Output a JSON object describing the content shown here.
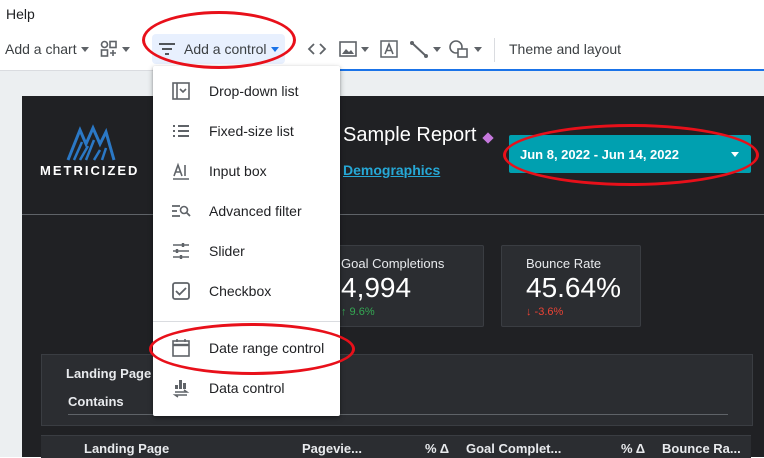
{
  "menubar": {
    "help": "Help"
  },
  "toolbar": {
    "add_chart": "Add a chart",
    "add_control": "Add a control",
    "theme_layout": "Theme and layout"
  },
  "control_menu": {
    "items": [
      {
        "label": "Drop-down list",
        "icon": "dropdown-list-icon"
      },
      {
        "label": "Fixed-size list",
        "icon": "fixed-size-list-icon"
      },
      {
        "label": "Input box",
        "icon": "input-box-icon"
      },
      {
        "label": "Advanced filter",
        "icon": "advanced-filter-icon"
      },
      {
        "label": "Slider",
        "icon": "slider-icon"
      },
      {
        "label": "Checkbox",
        "icon": "checkbox-icon"
      },
      {
        "label": "Date range control",
        "icon": "calendar-icon"
      },
      {
        "label": "Data control",
        "icon": "data-control-icon"
      }
    ]
  },
  "report": {
    "logo_text": "METRICIZED",
    "title": "Sample Report",
    "subtitle_link": "Demographics",
    "date_range": "Jun 8, 2022 - Jun 14, 2022",
    "scorecards": [
      {
        "title": "Goal Completions",
        "value": "4,994",
        "delta": "↑ 9.6%",
        "delta_color": "#34a853"
      },
      {
        "title": "Bounce Rate",
        "value": "45.64%",
        "delta": "↓ -3.6%",
        "delta_color": "#ea4335"
      }
    ],
    "filter": {
      "label": "Landing Page",
      "operator": "Contains"
    },
    "table_headers": [
      "Landing Page",
      "Pagevie...",
      "% Δ",
      "Goal Complet...",
      "% Δ",
      "Bounce Ra..."
    ]
  },
  "colors": {
    "accent": "#1a73e8",
    "date_button": "#00a0b0",
    "annotation": "#e8101a",
    "report_bg": "#202124"
  }
}
